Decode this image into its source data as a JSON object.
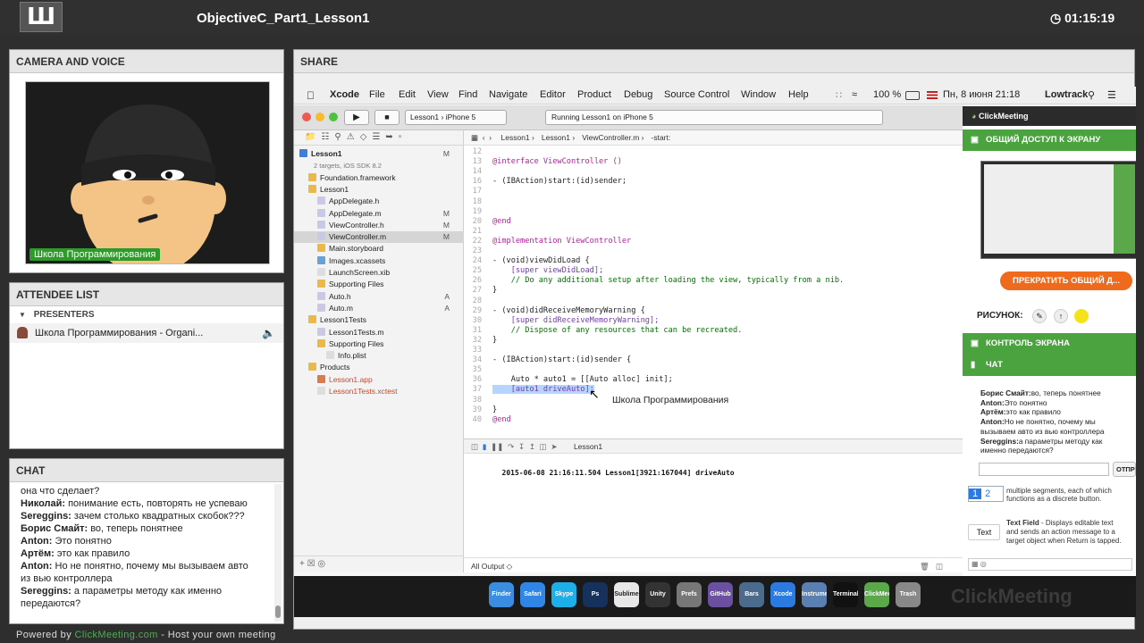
{
  "app": {
    "logo": "Ш",
    "title": "ObjectiveC_Part1_Lesson1",
    "timer": "01:15:19"
  },
  "camera": {
    "header": "CAMERA AND VOICE",
    "label": "Школа Программирования"
  },
  "attendees": {
    "header": "ATTENDEE LIST",
    "group": "PRESENTERS",
    "presenter": "Школа Программирования - Organi..."
  },
  "chat": {
    "header": "CHAT",
    "messages": [
      {
        "author": "",
        "text": "она что сделает?"
      },
      {
        "author": "Николай:",
        "text": " понимание есть, повторять не успеваю"
      },
      {
        "author": "Sereggins:",
        "text": " зачем столько квадратных скобок???"
      },
      {
        "author": "Борис Смайт:",
        "text": " во, теперь понятнее"
      },
      {
        "author": "Anton:",
        "text": " Это понятно"
      },
      {
        "author": "Артём:",
        "text": " это как правило"
      },
      {
        "author": "Anton:",
        "text": " Но не понятно, почему мы вызываем авто"
      },
      {
        "author": "",
        "text": "из вью контроллера"
      },
      {
        "author": "Sereggins:",
        "text": " а параметры методу как именно"
      },
      {
        "author": "",
        "text": "передаются?"
      }
    ]
  },
  "share": {
    "header": "SHARE"
  },
  "macmenu": {
    "items": [
      "Xcode",
      "File",
      "Edit",
      "View",
      "Find",
      "Navigate",
      "Editor",
      "Product",
      "Debug",
      "Source Control",
      "Window",
      "Help"
    ],
    "battery": "100 %",
    "datetime": "Пн, 8 июня  21:18",
    "user": "Lowtrack"
  },
  "xcode": {
    "scheme": "Lesson1",
    "device": "iPhone 5",
    "status": "Running Lesson1 on iPhone 5",
    "breadcrumb": [
      "Lesson1",
      "Lesson1",
      "ViewController.m",
      "-start:"
    ],
    "navigator": [
      {
        "name": "Lesson1",
        "badge": "M",
        "indent": 0,
        "color": "#3d7de0",
        "bold": true
      },
      {
        "name": "2 targets, iOS SDK 8.2",
        "badge": "",
        "indent": 0,
        "color": "",
        "sub": true
      },
      {
        "name": "Foundation.framework",
        "badge": "",
        "indent": 1,
        "color": "#e9b94a"
      },
      {
        "name": "Lesson1",
        "badge": "",
        "indent": 1,
        "color": "#e9b94a"
      },
      {
        "name": "AppDelegate.h",
        "badge": "",
        "indent": 2,
        "color": "#c9c9e6"
      },
      {
        "name": "AppDelegate.m",
        "badge": "M",
        "indent": 2,
        "color": "#c9c9e6"
      },
      {
        "name": "ViewController.h",
        "badge": "M",
        "indent": 2,
        "color": "#c9c9e6"
      },
      {
        "name": "ViewController.m",
        "badge": "M",
        "indent": 2,
        "color": "#c9c9e6",
        "selected": true
      },
      {
        "name": "Main.storyboard",
        "badge": "",
        "indent": 2,
        "color": "#e9b94a"
      },
      {
        "name": "Images.xcassets",
        "badge": "",
        "indent": 2,
        "color": "#6aa0d8"
      },
      {
        "name": "LaunchScreen.xib",
        "badge": "",
        "indent": 2,
        "color": "#dddddd"
      },
      {
        "name": "Supporting Files",
        "badge": "",
        "indent": 2,
        "color": "#e9b94a"
      },
      {
        "name": "Auto.h",
        "badge": "A",
        "indent": 2,
        "color": "#c9c9e6"
      },
      {
        "name": "Auto.m",
        "badge": "A",
        "indent": 2,
        "color": "#c9c9e6"
      },
      {
        "name": "Lesson1Tests",
        "badge": "",
        "indent": 1,
        "color": "#e9b94a"
      },
      {
        "name": "Lesson1Tests.m",
        "badge": "",
        "indent": 2,
        "color": "#c9c9e6"
      },
      {
        "name": "Supporting Files",
        "badge": "",
        "indent": 2,
        "color": "#e9b94a"
      },
      {
        "name": "Info.plist",
        "badge": "",
        "indent": 3,
        "color": "#dddddd"
      },
      {
        "name": "Products",
        "badge": "",
        "indent": 1,
        "color": "#e9b94a"
      },
      {
        "name": "Lesson1.app",
        "badge": "",
        "indent": 2,
        "color": "#d87b50",
        "red": true
      },
      {
        "name": "Lesson1Tests.xctest",
        "badge": "",
        "indent": 2,
        "color": "#dddddd",
        "red": true
      }
    ],
    "code": [
      {
        "n": "12",
        "t": ""
      },
      {
        "n": "13",
        "t": "@interface ViewController ()"
      },
      {
        "n": "14",
        "t": ""
      },
      {
        "n": "16",
        "t": "- (IBAction)start:(id)sender;"
      },
      {
        "n": "17",
        "t": ""
      },
      {
        "n": "18",
        "t": ""
      },
      {
        "n": "19",
        "t": ""
      },
      {
        "n": "20",
        "t": "@end"
      },
      {
        "n": "21",
        "t": ""
      },
      {
        "n": "22",
        "t": "@implementation ViewController"
      },
      {
        "n": "23",
        "t": ""
      },
      {
        "n": "24",
        "t": "- (void)viewDidLoad {"
      },
      {
        "n": "25",
        "t": "    [super viewDidLoad];"
      },
      {
        "n": "26",
        "t": "    // Do any additional setup after loading the view, typically from a nib."
      },
      {
        "n": "27",
        "t": "}"
      },
      {
        "n": "28",
        "t": ""
      },
      {
        "n": "29",
        "t": "- (void)didReceiveMemoryWarning {"
      },
      {
        "n": "30",
        "t": "    [super didReceiveMemoryWarning];"
      },
      {
        "n": "31",
        "t": "    // Dispose of any resources that can be recreated."
      },
      {
        "n": "32",
        "t": "}"
      },
      {
        "n": "33",
        "t": ""
      },
      {
        "n": "34",
        "t": "- (IBAction)start:(id)sender {"
      },
      {
        "n": "35",
        "t": ""
      },
      {
        "n": "36",
        "t": "    Auto * auto1 = [[Auto alloc] init];"
      },
      {
        "n": "37",
        "t": "    [auto1 driveAuto];"
      },
      {
        "n": "38",
        "t": ""
      },
      {
        "n": "39",
        "t": "}"
      },
      {
        "n": "40",
        "t": "@end"
      }
    ],
    "cursor_label": "Школа Программирования",
    "debug_target": "Lesson1",
    "console_line": "2015-06-08 21:16:11.504 Lesson1[3921:167044] driveAuto",
    "output_filter": "All Output ◇"
  },
  "clickmeeting": {
    "brand": "ClickMeeting",
    "screen_share": "ОБЩИЙ ДОСТУП К ЭКРАНУ",
    "stop_btn": "ПРЕКРАТИТЬ ОБЩИЙ Д...",
    "drawing": "РИСУНОК:",
    "screen_control": "КОНТРОЛЬ ЭКРАНА",
    "chat": "ЧАТ",
    "send": "ОТПР",
    "chat_lines": [
      {
        "author": "Борис Смайт:",
        "text": "во, теперь понятнее"
      },
      {
        "author": "Anton:",
        "text": "Это понятно"
      },
      {
        "author": "Артём:",
        "text": "это как правило"
      },
      {
        "author": "Anton:",
        "text": "Но не понятно, почему мы"
      },
      {
        "author": "",
        "text": "вызываем авто из вью контроллера"
      },
      {
        "author": "Sereggins:",
        "text": "а параметры методу как"
      },
      {
        "author": "",
        "text": "именно передаются?"
      }
    ]
  },
  "library": {
    "seg_text1": "multiple segments, each of which",
    "seg_text2": "functions as a discrete button.",
    "tf_label": "Text",
    "tf_title": "Text Field",
    "tf_text1": " - Displays editable text",
    "tf_text2": "and sends an action message to a",
    "tf_text3": "target object when Return is tapped."
  },
  "dock": [
    "Finder",
    "Safari",
    "Skype",
    "Ps",
    "Sublime",
    "Unity",
    "Prefs",
    "GitHub",
    "Bars",
    "Xcode",
    "Instruments",
    "Terminal",
    "ClickMeeting",
    "Trash"
  ],
  "footer": {
    "pre": "Powered by ",
    "link": "ClickMeeting.com",
    "post": " - Host your own meeting"
  }
}
